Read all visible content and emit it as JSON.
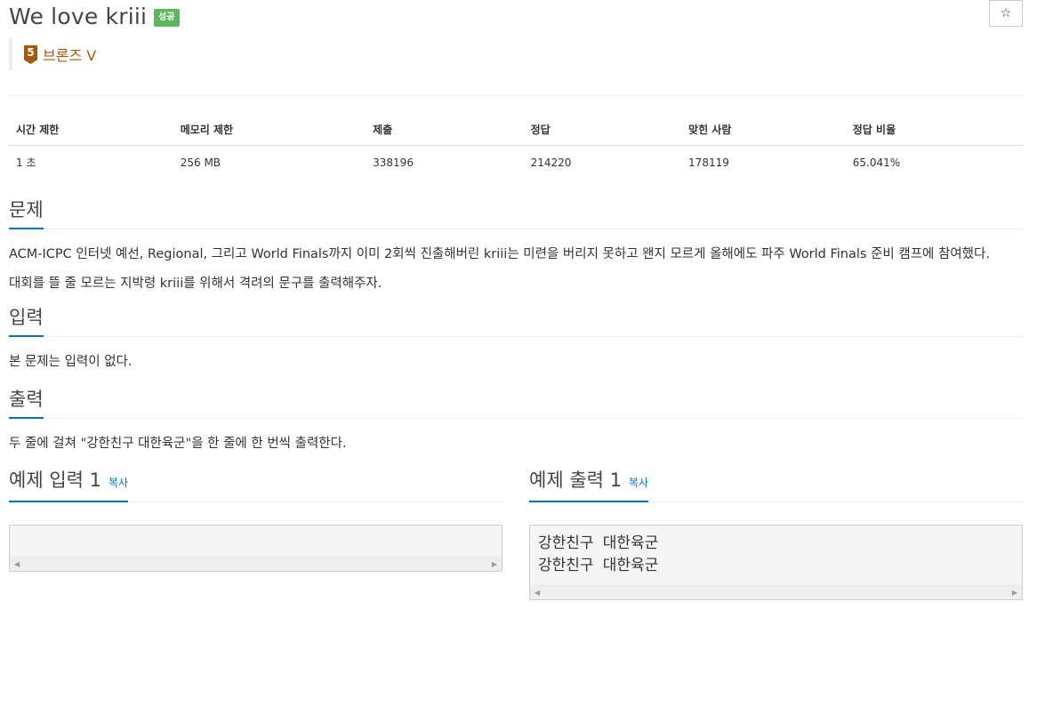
{
  "problem": {
    "title": "We love kriii",
    "status_badge": "성공",
    "star_glyph": "☆",
    "tier": {
      "level": "5",
      "label": "브론즈 V",
      "color": "#ad5600"
    }
  },
  "info_table": {
    "headers": [
      "시간 제한",
      "메모리 제한",
      "제출",
      "정답",
      "맞힌 사람",
      "정답 비율"
    ],
    "values": [
      "1 초",
      "256 MB",
      "338196",
      "214220",
      "178119",
      "65.041%"
    ]
  },
  "sections": {
    "description": {
      "heading": "문제",
      "paragraphs": [
        "ACM-ICPC 인터넷 예선, Regional, 그리고 World Finals까지 이미 2회씩 진출해버린 kriii는 미련을 버리지 못하고 왠지 모르게 올해에도 파주 World Finals 준비 캠프에 참여했다.",
        "대회를 뜰 줄 모르는 지박령 kriii를 위해서 격려의 문구를 출력해주자."
      ]
    },
    "input": {
      "heading": "입력",
      "text": "본 문제는 입력이 없다."
    },
    "output": {
      "heading": "출력",
      "text": "두 줄에 걸쳐 \"강한친구 대한육군\"을 한 줄에 한 번씩 출력한다."
    }
  },
  "samples": {
    "input": {
      "heading": "예제 입력 1",
      "copy_label": "복사",
      "content": ""
    },
    "output": {
      "heading": "예제 출력 1",
      "copy_label": "복사",
      "content": "강한친구 대한육군\n강한친구 대한육군"
    }
  },
  "icons": {
    "star": "star-icon",
    "tier": "bronze-tier-icon",
    "scroll_left": "scroll-left-arrow-icon",
    "scroll_right": "scroll-right-arrow-icon"
  },
  "colors": {
    "accent": "#0076c0",
    "success": "#5cb85c",
    "bronze": "#ad5600"
  }
}
